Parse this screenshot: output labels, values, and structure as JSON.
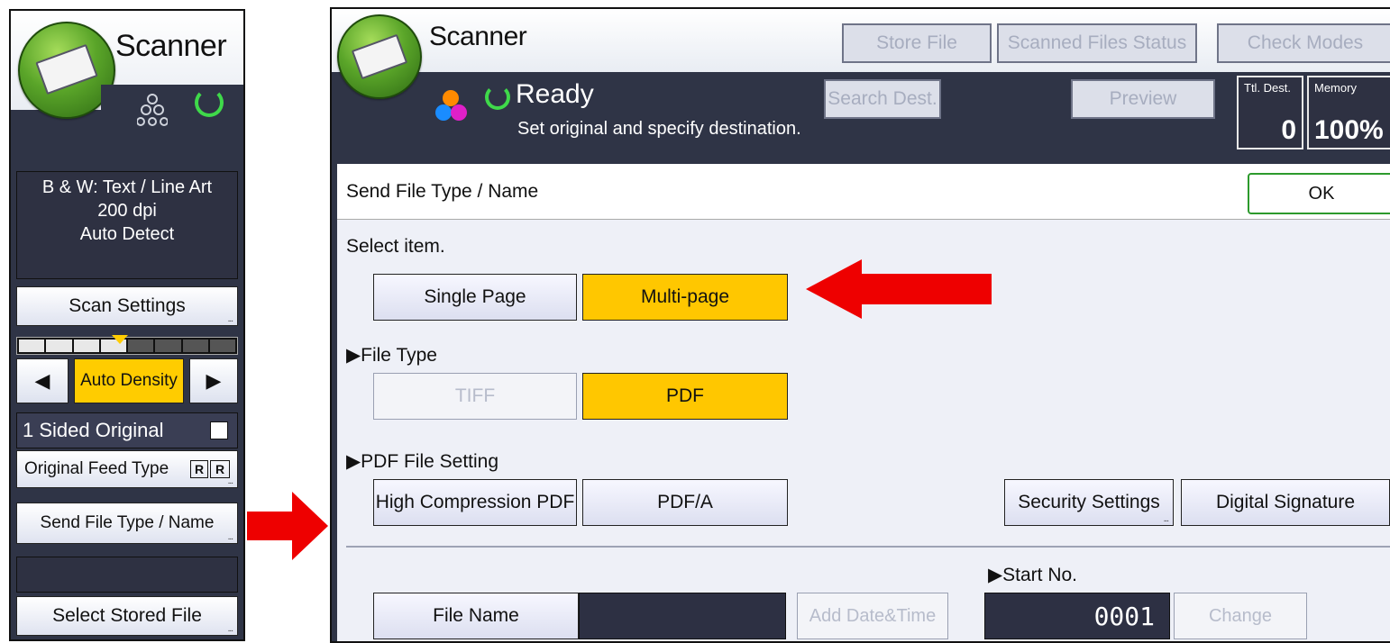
{
  "left_panel": {
    "app_title": "Scanner",
    "summary": [
      "B & W: Text / Line Art",
      "200 dpi",
      "Auto Detect"
    ],
    "scan_settings_label": "Scan Settings",
    "density_label": "Auto Density",
    "density_left_icon": "left-triangle-icon",
    "density_right_icon": "right-triangle-icon",
    "original_sides_label": "1 Sided Original",
    "original_feed_type_label": "Original Feed Type",
    "send_file_type_label": "Send File Type / Name",
    "select_stored_file_label": "Select Stored File",
    "colors": {
      "accent_yellow": "#ffcc00",
      "panel_dark": "#2f3446"
    }
  },
  "right_panel": {
    "app_title": "Scanner",
    "top_buttons": {
      "store_file": "Store File",
      "scanned_files_status": "Scanned Files Status",
      "check_modes": "Check Modes"
    },
    "status": {
      "title": "Ready",
      "message": "Set original and specify destination."
    },
    "search_dest_label": "Search Dest.",
    "preview_label": "Preview",
    "ttl_dest": {
      "label": "Ttl. Dest.",
      "value": "0"
    },
    "memory": {
      "label": "Memory",
      "value": "100%"
    },
    "section_title": "Send File Type / Name",
    "ok_label": "OK",
    "select_item_label": "Select item.",
    "page_options": [
      {
        "label": "Single Page",
        "selected": false
      },
      {
        "label": "Multi-page",
        "selected": true
      }
    ],
    "file_type_heading": "▶File Type",
    "file_type_options": [
      {
        "label": "TIFF",
        "selected": false,
        "disabled": true
      },
      {
        "label": "PDF",
        "selected": true,
        "disabled": false
      }
    ],
    "pdf_setting_heading": "▶PDF File Setting",
    "pdf_setting_buttons": {
      "high_compression": "High Compression PDF",
      "pdf_a": "PDF/A",
      "security": "Security Settings",
      "digital_signature": "Digital Signature"
    },
    "start_no_heading": "▶Start No.",
    "start_no_value": "0001",
    "file_name_label": "File Name",
    "add_date_time_label": "Add Date&Time",
    "change_label": "Change",
    "colors": {
      "selected_yellow": "#ffc700",
      "ok_border": "#2c9a2c",
      "arrow_red": "#ee0000"
    }
  }
}
